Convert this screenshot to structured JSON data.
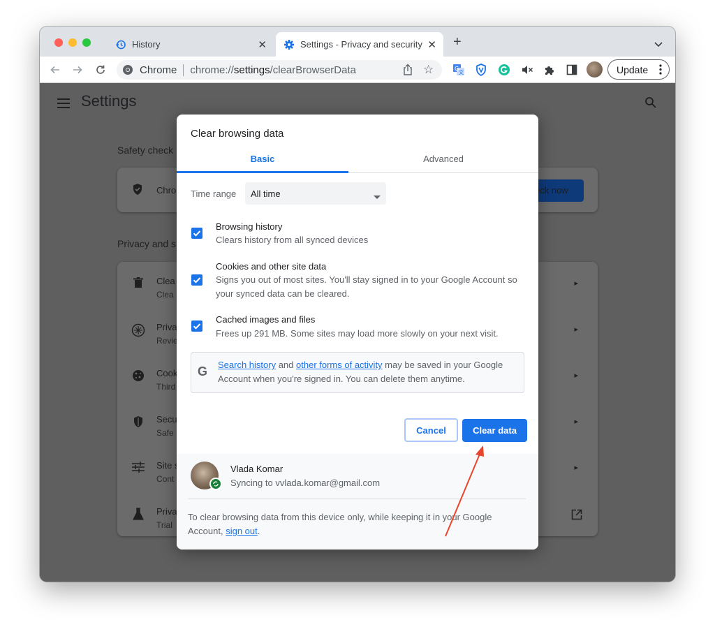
{
  "browser": {
    "tabs": [
      {
        "label": "History",
        "icon": "history-icon"
      },
      {
        "label": "Settings - Privacy and security",
        "icon": "settings-icon"
      }
    ],
    "omnibox": {
      "scheme_label": "Chrome",
      "url_prefix": "chrome://",
      "url_bold": "settings",
      "url_rest": "/clearBrowserData"
    },
    "update_label": "Update"
  },
  "settings": {
    "title": "Settings",
    "safety_check": {
      "heading": "Safety check",
      "row_title": "Chro",
      "button": "eck now"
    },
    "privacy": {
      "heading": "Privacy and s",
      "rows": [
        {
          "title": "Clea",
          "subtitle": "Clea",
          "icon": "trash-icon"
        },
        {
          "title": "Priva",
          "subtitle": "Revie",
          "icon": "compass-icon"
        },
        {
          "title": "Cook",
          "subtitle": "Third",
          "icon": "cookie-icon"
        },
        {
          "title": "Secu",
          "subtitle": "Safe",
          "icon": "shield-icon"
        },
        {
          "title": "Site s",
          "subtitle": "Cont",
          "icon": "sliders-icon"
        },
        {
          "title": "Priva",
          "subtitle": "Trial",
          "icon": "flask-icon"
        }
      ]
    }
  },
  "dialog": {
    "title": "Clear browsing data",
    "tabs": {
      "basic": "Basic",
      "advanced": "Advanced"
    },
    "time_range": {
      "label": "Time range",
      "selected": "All time"
    },
    "options": [
      {
        "title": "Browsing history",
        "description": "Clears history from all synced devices",
        "checked": true
      },
      {
        "title": "Cookies and other site data",
        "description": "Signs you out of most sites. You'll stay signed in to your Google Account so your synced data can be cleared.",
        "checked": true
      },
      {
        "title": "Cached images and files",
        "description": "Frees up 291 MB. Some sites may load more slowly on your next visit.",
        "checked": true
      }
    ],
    "google_notice": {
      "link1": "Search history",
      "and": " and ",
      "link2": "other forms of activity",
      "rest": " may be saved in your Google Account when you're signed in. You can delete them anytime."
    },
    "buttons": {
      "cancel": "Cancel",
      "clear": "Clear data"
    },
    "account": {
      "name": "Vlada Komar",
      "sync": "Syncing to vvlada.komar@gmail.com"
    },
    "footer": {
      "text": "To clear browsing data from this device only, while keeping it in your Google Account, ",
      "link": "sign out",
      "end": "."
    }
  },
  "colors": {
    "accent": "#1a73e8",
    "annotation_arrow": "#e8452c"
  }
}
